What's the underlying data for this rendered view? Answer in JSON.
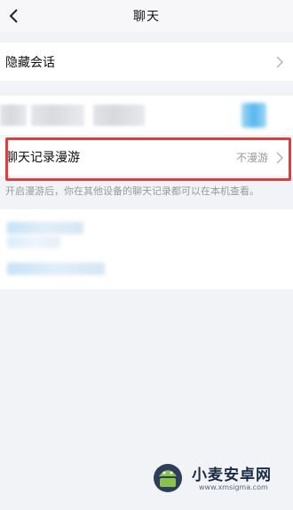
{
  "header": {
    "title": "聊天"
  },
  "hidden_chats": {
    "label": "隐藏会话"
  },
  "roaming": {
    "label": "聊天记录漫游",
    "value": "不漫游",
    "hint": "开启漫游后，你在其他设备的聊天记录都可以在本机查看。"
  },
  "watermark": {
    "text": "小麦安卓网",
    "url": "www.xmsigma.com"
  },
  "colors": {
    "highlight": "#e23c3c",
    "background": "#f2f3f6"
  }
}
